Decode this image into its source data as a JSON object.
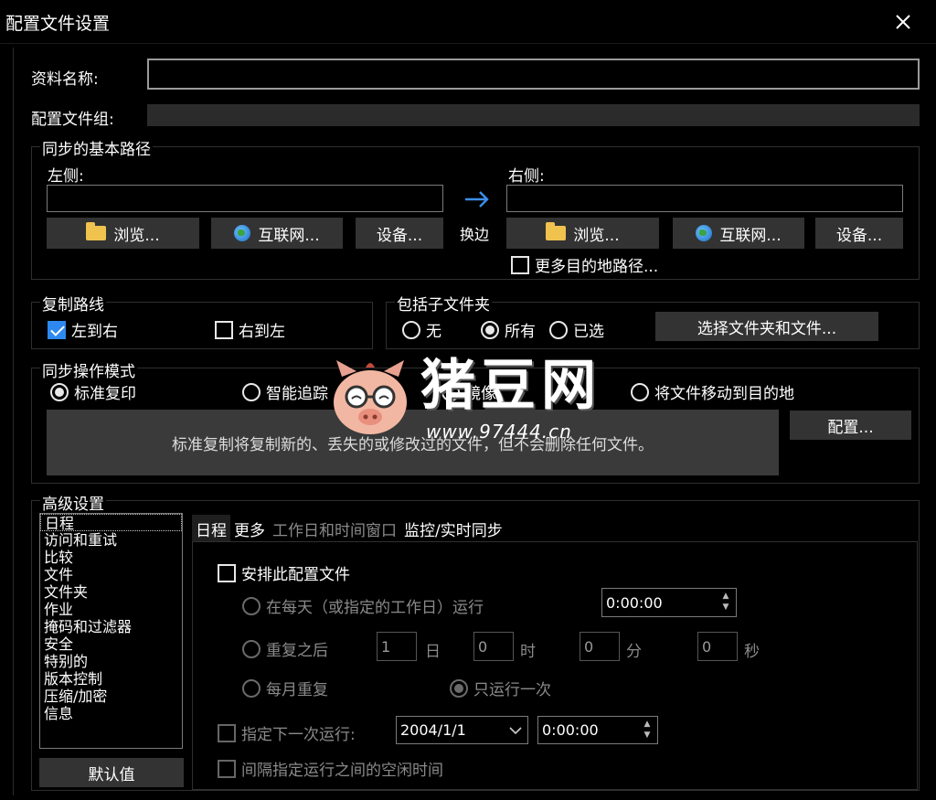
{
  "window": {
    "title": "配置文件设置",
    "close_label": "✕"
  },
  "profile": {
    "name_label": "资料名称:",
    "name_value": "",
    "group_label": "配置文件组:",
    "group_value": ""
  },
  "base_paths": {
    "title": "同步的基本路径",
    "left": {
      "label": "左侧:",
      "value": "",
      "browse": "浏览...",
      "internet": "互联网...",
      "device": "设备..."
    },
    "right": {
      "label": "右侧:",
      "value": "",
      "browse": "浏览...",
      "internet": "互联网...",
      "device": "设备..."
    },
    "swap_arrow": "→",
    "swap_label": "换边",
    "more_dest_label": "更多目的地路径...",
    "more_dest_checked": false
  },
  "copy_direction": {
    "title": "复制路线",
    "ltr_label": "左到右",
    "ltr_checked": true,
    "rtl_label": "右到左",
    "rtl_checked": false
  },
  "subfolders": {
    "title": "包括子文件夹",
    "options": [
      "无",
      "所有",
      "已选"
    ],
    "selected": "所有",
    "select_button": "选择文件夹和文件..."
  },
  "sync_mode": {
    "title": "同步操作模式",
    "options": [
      "标准复印",
      "智能追踪",
      "镜像",
      "将文件移动到目的地"
    ],
    "selected": "标准复印",
    "description": "标准复制将复制新的、丢失的或修改过的文件，但不会删除任何文件。",
    "config_button": "配置..."
  },
  "watermark": {
    "brand": "猪豆网",
    "url": "www.97444.cn"
  },
  "advanced": {
    "title": "高级设置",
    "categories": [
      "日程",
      "访问和重试",
      "比较",
      "文件",
      "文件夹",
      "作业",
      "掩码和过滤器",
      "安全",
      "特别的",
      "版本控制",
      "压缩/加密",
      "信息"
    ],
    "selected_category": "日程",
    "defaults_button": "默认值",
    "tabs": [
      "日程",
      "更多",
      "工作日和时间窗口",
      "监控/实时同步"
    ],
    "active_tab": "日程",
    "schedule": {
      "schedule_label": "安排此配置文件",
      "schedule_checked": false,
      "daily_label": "在每天（或指定的工作日）运行",
      "daily_time": "0:00:00",
      "repeat_label": "重复之后",
      "repeat_days": "1",
      "days_unit": "日",
      "repeat_hours": "0",
      "hours_unit": "时",
      "repeat_minutes": "0",
      "minutes_unit": "分",
      "repeat_seconds": "0",
      "seconds_unit": "秒",
      "monthly_label": "每月重复",
      "once_label": "只运行一次",
      "selected_mode": "只运行一次",
      "next_run_label": "指定下一次运行:",
      "next_run_date": "2004/1/1",
      "next_run_time": "0:00:00",
      "interval_label": "间隔指定运行之间的空闲时间"
    }
  }
}
